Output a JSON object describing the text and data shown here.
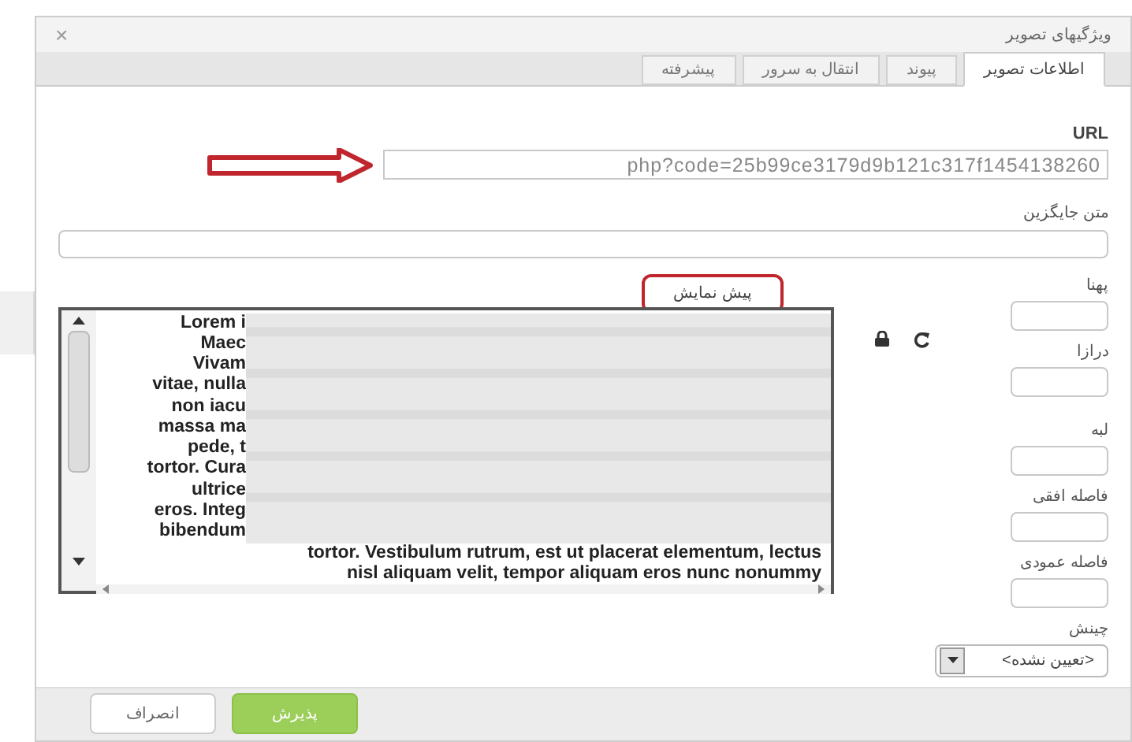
{
  "dialog": {
    "title": "ویژگیهای تصویر",
    "close": "×"
  },
  "tabs": [
    {
      "label": "اطلاعات تصویر",
      "selected": true
    },
    {
      "label": "پیوند",
      "selected": false
    },
    {
      "label": "انتقال به سرور",
      "selected": false
    },
    {
      "label": "پیشرفته",
      "selected": false
    }
  ],
  "url": {
    "label": "URL",
    "value": "php?code=25b99ce3179d9b121c317f1454138260"
  },
  "alt_text": {
    "label": "متن جایگزین"
  },
  "preview": {
    "label": "پیش نمایش",
    "covered_lines": [
      "Lorem i",
      "Maec",
      "Vivam",
      "vitae, nulla",
      "non iacu",
      "massa ma",
      "pede, t",
      "tortor. Cura",
      "ultrice",
      "eros. Integ",
      "bibendum"
    ],
    "lines": [
      "tortor. Vestibulum rutrum, est ut placerat elementum, lectus",
      "nisl aliquam velit, tempor aliquam eros nunc nonummy"
    ]
  },
  "fields": [
    {
      "kind": "text",
      "label": "پهنا"
    },
    {
      "kind": "text",
      "label": "درازا"
    },
    {
      "kind": "text",
      "label": "لبه"
    },
    {
      "kind": "text",
      "label": "فاصله افقی"
    },
    {
      "kind": "text",
      "label": "فاصله عمودی"
    },
    {
      "kind": "select",
      "label": "چینش",
      "value": "<تعیین نشده>"
    }
  ],
  "buttons": [
    {
      "label": "پذیرش",
      "kind": "ok"
    },
    {
      "label": "انصراف",
      "kind": "cancel"
    }
  ]
}
